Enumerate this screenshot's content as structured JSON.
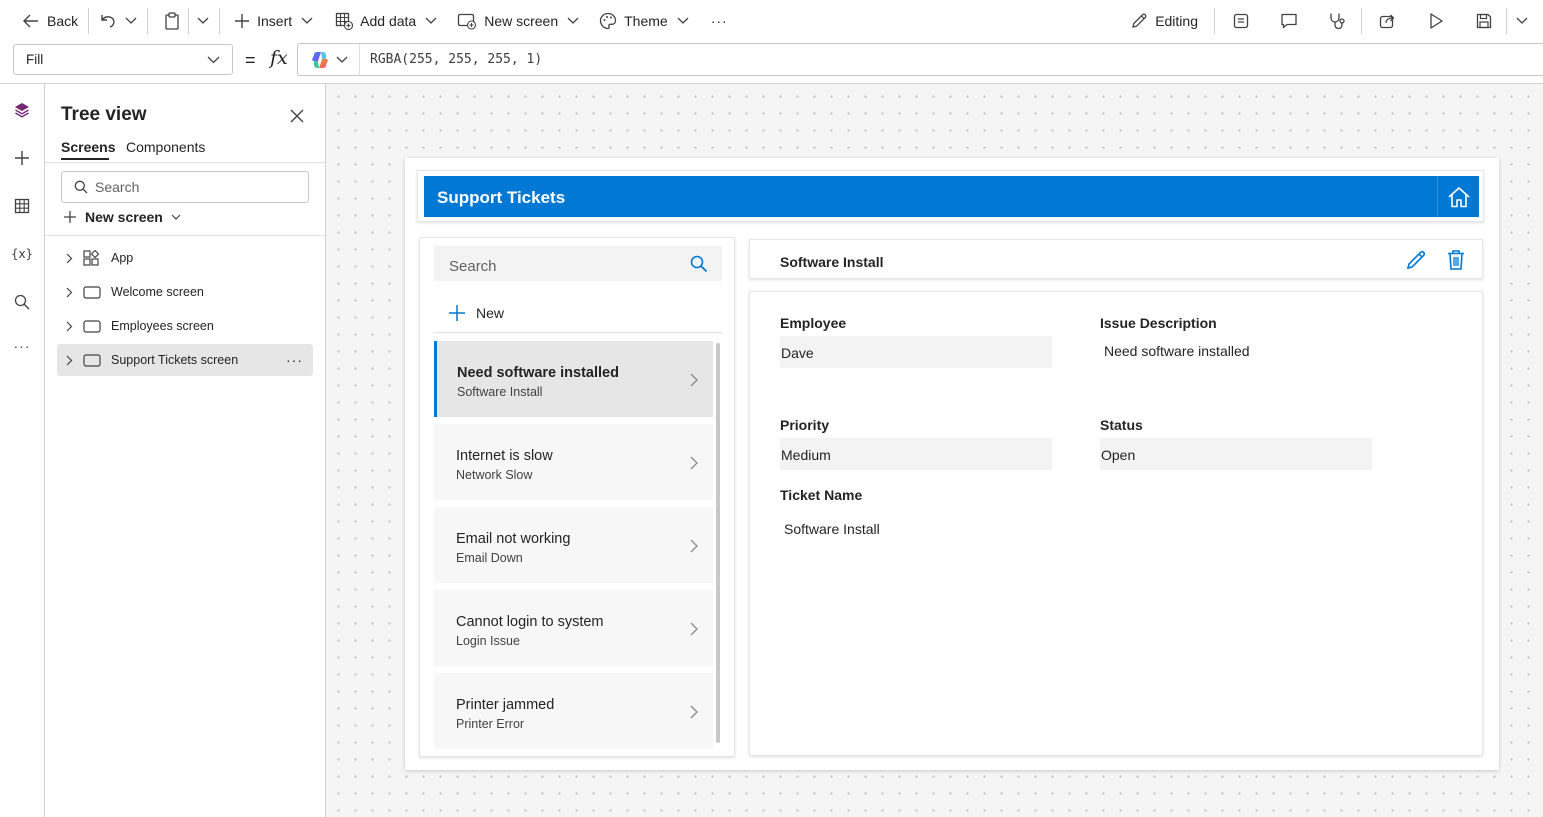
{
  "toolbar": {
    "back_label": "Back",
    "insert_label": "Insert",
    "add_data_label": "Add data",
    "new_screen_label": "New screen",
    "theme_label": "Theme",
    "more_label": "···",
    "editing_label": "Editing"
  },
  "formula_bar": {
    "property": "Fill",
    "equals": "=",
    "fx": "fx",
    "formula": "RGBA(255, 255, 255, 1)"
  },
  "tree_view": {
    "title": "Tree view",
    "tabs": [
      "Screens",
      "Components"
    ],
    "search_placeholder": "Search",
    "new_screen_label": "New screen",
    "nodes": [
      {
        "label": "App",
        "icon": "app-icon"
      },
      {
        "label": "Welcome screen",
        "icon": "screen-icon"
      },
      {
        "label": "Employees screen",
        "icon": "screen-icon"
      },
      {
        "label": "Support Tickets screen",
        "icon": "screen-icon",
        "selected": true
      }
    ],
    "more_label": "···"
  },
  "app": {
    "header_title": "Support Tickets",
    "list": {
      "search_placeholder": "Search",
      "new_label": "New",
      "items": [
        {
          "title": "Need software installed",
          "subtitle": "Software Install",
          "selected": true
        },
        {
          "title": "Internet is slow",
          "subtitle": "Network Slow"
        },
        {
          "title": "Email not working",
          "subtitle": "Email Down"
        },
        {
          "title": "Cannot login to system",
          "subtitle": "Login Issue"
        },
        {
          "title": "Printer jammed",
          "subtitle": "Printer Error"
        }
      ]
    },
    "detail": {
      "title": "Software Install",
      "fields": {
        "employee_label": "Employee",
        "employee_value": "Dave",
        "issue_label": "Issue Description",
        "issue_value": "Need software installed",
        "priority_label": "Priority",
        "priority_value": "Medium",
        "status_label": "Status",
        "status_value": "Open",
        "ticket_label": "Ticket Name",
        "ticket_value": "Software Install"
      }
    }
  },
  "colors": {
    "accent": "#0078d4",
    "brand_purple": "#742774"
  }
}
